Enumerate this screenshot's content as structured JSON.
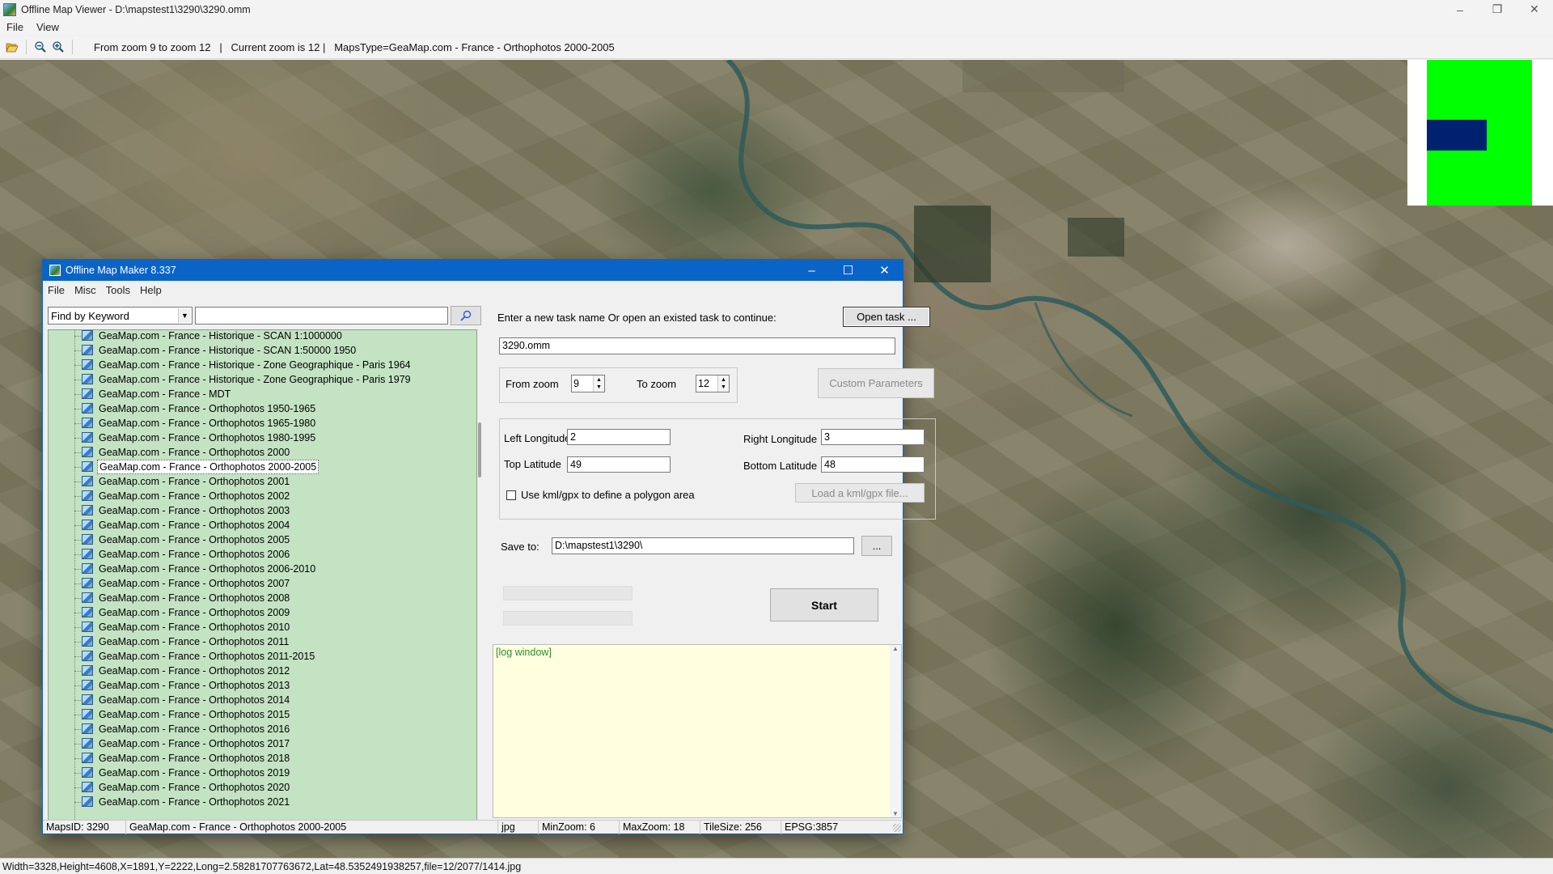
{
  "viewer": {
    "title": "Offline Map Viewer - D:\\mapstest1\\3290\\3290.omm",
    "menu": [
      "File",
      "View"
    ],
    "toolbar_info": "From zoom 9 to zoom 12   |   Current zoom is 12 |   MapsType=GeaMap.com - France - Orthophotos 2000-2005",
    "status": "Width=3328,Height=4608,X=1891,Y=2222,Long=2.58281707763672,Lat=48.5352491938257,file=12/2077/1414.jpg"
  },
  "dialog": {
    "title": "Offline Map Maker 8.337",
    "menu": [
      "File",
      "Misc",
      "Tools",
      "Help"
    ],
    "find_mode": "Find by Keyword",
    "search_value": "",
    "tree_items": [
      "GeaMap.com - France - Historique - SCAN 1:1000000",
      "GeaMap.com - France - Historique - SCAN 1:50000 1950",
      "GeaMap.com - France - Historique - Zone Geographique - Paris 1964",
      "GeaMap.com - France - Historique - Zone Geographique - Paris 1979",
      "GeaMap.com - France - MDT",
      "GeaMap.com - France - Orthophotos 1950-1965",
      "GeaMap.com - France - Orthophotos 1965-1980",
      "GeaMap.com - France - Orthophotos 1980-1995",
      "GeaMap.com - France - Orthophotos 2000",
      "GeaMap.com - France - Orthophotos 2000-2005",
      "GeaMap.com - France - Orthophotos 2001",
      "GeaMap.com - France - Orthophotos 2002",
      "GeaMap.com - France - Orthophotos 2003",
      "GeaMap.com - France - Orthophotos 2004",
      "GeaMap.com - France - Orthophotos 2005",
      "GeaMap.com - France - Orthophotos 2006",
      "GeaMap.com - France - Orthophotos 2006-2010",
      "GeaMap.com - France - Orthophotos 2007",
      "GeaMap.com - France - Orthophotos 2008",
      "GeaMap.com - France - Orthophotos 2009",
      "GeaMap.com - France - Orthophotos 2010",
      "GeaMap.com - France - Orthophotos 2011",
      "GeaMap.com - France - Orthophotos 2011-2015",
      "GeaMap.com - France - Orthophotos 2012",
      "GeaMap.com - France - Orthophotos 2013",
      "GeaMap.com - France - Orthophotos 2014",
      "GeaMap.com - France - Orthophotos 2015",
      "GeaMap.com - France - Orthophotos 2016",
      "GeaMap.com - France - Orthophotos 2017",
      "GeaMap.com - France - Orthophotos 2018",
      "GeaMap.com - France - Orthophotos 2019",
      "GeaMap.com - France - Orthophotos 2020",
      "GeaMap.com - France - Orthophotos 2021"
    ],
    "selected_item": "GeaMap.com - France - Orthophotos 2000-2005",
    "task_prompt": "Enter a new task name Or open an existed task to continue:",
    "open_task_label": "Open task ...",
    "task_name": "3290.omm",
    "from_zoom_label": "From zoom",
    "from_zoom": "9",
    "to_zoom_label": "To zoom",
    "to_zoom": "12",
    "custom_params_label": "Custom Parameters",
    "left_lon_label": "Left Longitude",
    "left_lon": "2",
    "right_lon_label": "Right Longitude",
    "right_lon": "3",
    "top_lat_label": "Top Latitude",
    "top_lat": "49",
    "bottom_lat_label": "Bottom Latitude",
    "bottom_lat": "48",
    "kml_label": "Use kml/gpx to define a polygon area",
    "load_kml_label": "Load a kml/gpx file...",
    "save_to_label": "Save to:",
    "save_to": "D:\\mapstest1\\3290\\",
    "browse_label": "...",
    "start_label": "Start",
    "log_text": "[log window]",
    "status": {
      "maps_id": "MapsID: 3290",
      "map_name": "GeaMap.com - France - Orthophotos 2000-2005",
      "format": "jpg",
      "min_zoom": "MinZoom: 6",
      "max_zoom": "MaxZoom: 18",
      "tile_size": "TileSize: 256",
      "epsg": "EPSG:3857"
    }
  },
  "colors": {
    "tree_bg": "#c3e3c3",
    "dialog_title": "#0a64c8",
    "log_bg": "#ffffe0",
    "minimap_green": "#00ff00",
    "minimap_view": "#002070"
  },
  "icons": [
    "open-folder-icon",
    "zoom-out-icon",
    "zoom-in-icon",
    "search-icon",
    "map-icon"
  ]
}
